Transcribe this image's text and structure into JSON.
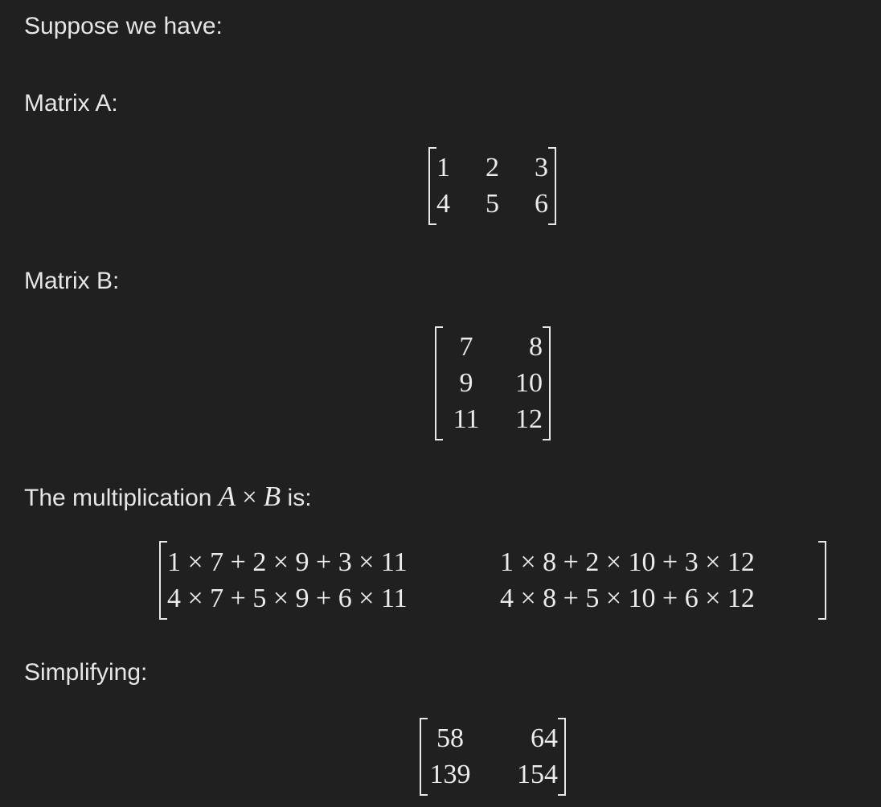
{
  "texts": {
    "intro": "Suppose we have:",
    "matrix_a_label": "Matrix A:",
    "matrix_b_label": "Matrix B:",
    "mult_prefix": "The multiplication ",
    "mult_a": "A",
    "mult_op": "×",
    "mult_b": "B",
    "mult_suffix": " is:",
    "simplifying": "Simplifying:"
  },
  "matrices": {
    "a": [
      [
        "1",
        "2",
        "3"
      ],
      [
        "4",
        "5",
        "6"
      ]
    ],
    "b": [
      [
        "7",
        "8"
      ],
      [
        "9",
        "10"
      ],
      [
        "11",
        "12"
      ]
    ],
    "product_expanded": [
      [
        "1 × 7 + 2 × 9 + 3 × 11",
        "1 × 8 + 2 × 10 + 3 × 12"
      ],
      [
        "4 × 7 + 5 × 9 + 6 × 11",
        "4 × 8 + 5 × 10 + 6 × 12"
      ]
    ],
    "result": [
      [
        "58",
        "64"
      ],
      [
        "139",
        "154"
      ]
    ]
  }
}
